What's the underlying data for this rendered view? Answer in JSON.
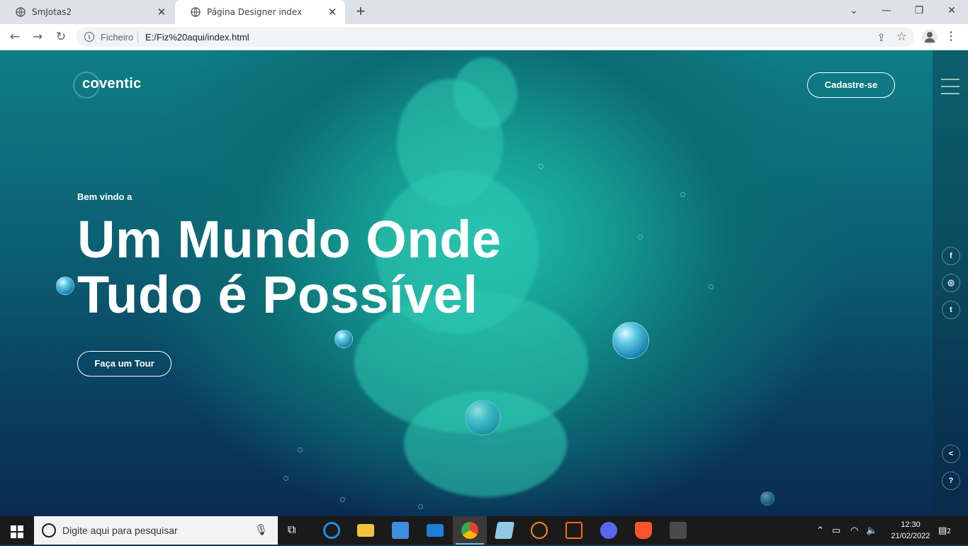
{
  "browser": {
    "tabs": [
      {
        "title": "SmJotas2",
        "active": false
      },
      {
        "title": "Página Designer index",
        "active": true
      }
    ],
    "address": {
      "label": "Ficheiro",
      "url": "E:/Fiz%20aqui/index.html"
    }
  },
  "site": {
    "logo": "coventic",
    "signup": "Cadastre-se",
    "welcome": "Bem vindo a",
    "headline_line1": "Um Mundo Onde",
    "headline_line2": "Tudo é Possível",
    "tour": "Faça um Tour",
    "social": [
      {
        "icon": "facebook-icon",
        "glyph": "f"
      },
      {
        "icon": "instagram-icon",
        "glyph": "◎"
      },
      {
        "icon": "twitter-icon",
        "glyph": "t"
      }
    ],
    "side_bottom": [
      {
        "icon": "share-icon",
        "glyph": "<"
      },
      {
        "icon": "help-icon",
        "glyph": "?"
      }
    ]
  },
  "taskbar": {
    "search_placeholder": "Digite aqui para pesquisar",
    "time": "12:30",
    "date": "21/02/2022",
    "notifications": "2"
  }
}
